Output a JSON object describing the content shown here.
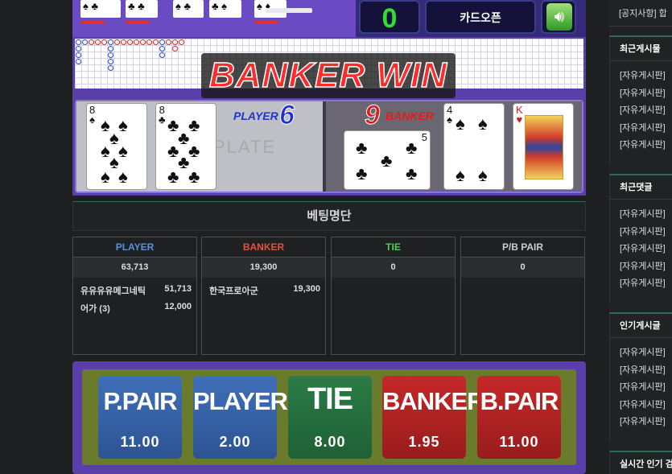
{
  "game": {
    "score": "0",
    "card_open_label": "카드오픈",
    "banner": "BANKER WIN",
    "player_label": "PLAYER",
    "player_score": "6",
    "banker_label": "BANKER",
    "banker_score": "9",
    "plate_text": "PLATE",
    "player_cards": [
      {
        "rank": "8",
        "suit": "♠"
      },
      {
        "rank": "8",
        "suit": "♣"
      }
    ],
    "banker_cards": [
      {
        "rank": "5",
        "suit": "♣"
      },
      {
        "rank": "4",
        "suit": "♠"
      },
      {
        "rank": "K",
        "suit": "♥"
      }
    ]
  },
  "betting": {
    "title": "베팅명단",
    "columns": [
      {
        "name": "PLAYER",
        "color": "#5b8fe0",
        "total": "63,713",
        "rows": [
          {
            "name": "유유유유메그네틱",
            "amount": "51,713"
          },
          {
            "name": "어가 (3)",
            "amount": "12,000"
          }
        ]
      },
      {
        "name": "BANKER",
        "color": "#e0553a",
        "total": "19,300",
        "rows": [
          {
            "name": "한국프로아군",
            "amount": "19,300"
          }
        ]
      },
      {
        "name": "TIE",
        "color": "#4fcf4f",
        "total": "0",
        "rows": []
      },
      {
        "name": "P/B PAIR",
        "color": "#cccccc",
        "total": "0",
        "rows": []
      }
    ]
  },
  "bet_buttons": [
    {
      "label": "P.PAIR",
      "odds": "11.00",
      "color": "blue"
    },
    {
      "label": "PLAYER",
      "odds": "2.00",
      "color": "blue"
    },
    {
      "label": "TIE",
      "odds": "8.00",
      "color": "green"
    },
    {
      "label": "BANKER",
      "odds": "1.95",
      "color": "red"
    },
    {
      "label": "B.PAIR",
      "odds": "11.00",
      "color": "red"
    }
  ],
  "sidebar": {
    "notice": "[공지사항] 합",
    "sections": [
      {
        "title": "최근게시물",
        "items": [
          "[자유게시판]",
          "[자유게시판]",
          "[자유게시판]",
          "[자유게시판]",
          "[자유게시판]"
        ]
      },
      {
        "title": "최근댓글",
        "items": [
          "[자유게시판]",
          "[자유게시판]",
          "[자유게시판]",
          "[자유게시판]",
          "[자유게시판]"
        ]
      },
      {
        "title": "인기게시글",
        "items": [
          "[자유게시판]",
          "[자유게시판]",
          "[자유게시판]",
          "[자유게시판]",
          "[자유게시판]"
        ]
      },
      {
        "title": "실시간 인기 검",
        "items": []
      }
    ]
  }
}
